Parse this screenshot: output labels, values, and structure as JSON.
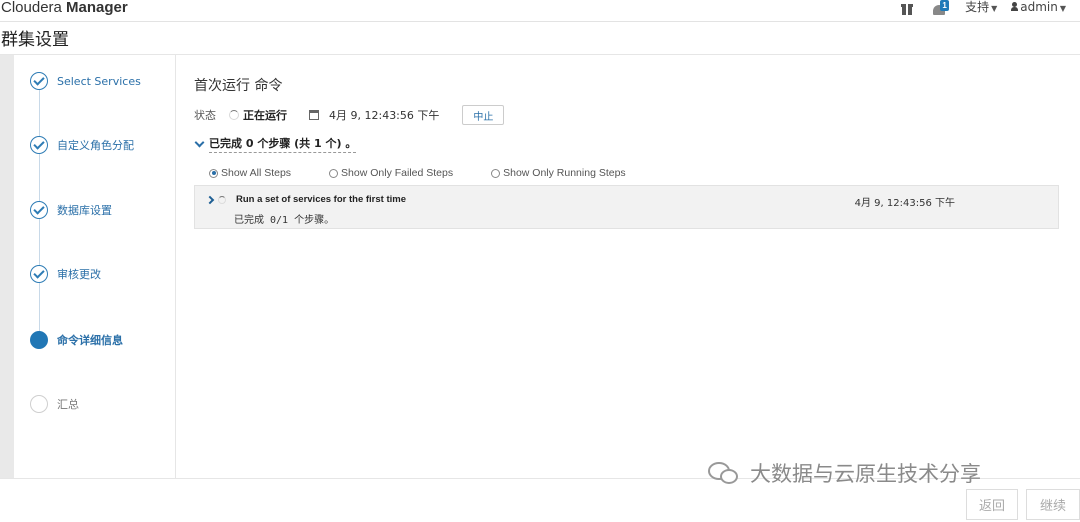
{
  "header": {
    "brand_part1": "Cloudera",
    "brand_part2": "Manager",
    "notification_count": "1",
    "support_label": "支持",
    "user_label": "admin",
    "icons": [
      "gift-icon",
      "bell-icon",
      "user-icon"
    ]
  },
  "page": {
    "title": "群集设置"
  },
  "wizard": {
    "steps": [
      {
        "label": "Select Services",
        "state": "done"
      },
      {
        "label": "自定义角色分配",
        "state": "done"
      },
      {
        "label": "数据库设置",
        "state": "done"
      },
      {
        "label": "审核更改",
        "state": "done"
      },
      {
        "label": "命令详细信息",
        "state": "active"
      },
      {
        "label": "汇总",
        "state": "todo"
      }
    ]
  },
  "command": {
    "heading": "首次运行 命令",
    "status_label": "状态",
    "status_value": "正在运行",
    "timestamp": "4月 9, 12:43:56 下午",
    "abort_label": "中止",
    "summary": "已完成 0 个步骤 (共 1 个) 。",
    "filters": [
      {
        "label": "Show All Steps",
        "selected": true
      },
      {
        "label": "Show Only Failed Steps",
        "selected": false
      },
      {
        "label": "Show Only Running Steps",
        "selected": false
      }
    ],
    "subcommand": {
      "name": "Run a set of services for the first time",
      "time": "4月 9, 12:43:56 下午",
      "progress": "已完成 0/1 个步骤。"
    }
  },
  "footer": {
    "back_label": "返回",
    "continue_label": "继续",
    "watermark": "大数据与云原生技术分享"
  },
  "colors": {
    "accent": "#2177b5",
    "link": "#2a6fa8"
  }
}
